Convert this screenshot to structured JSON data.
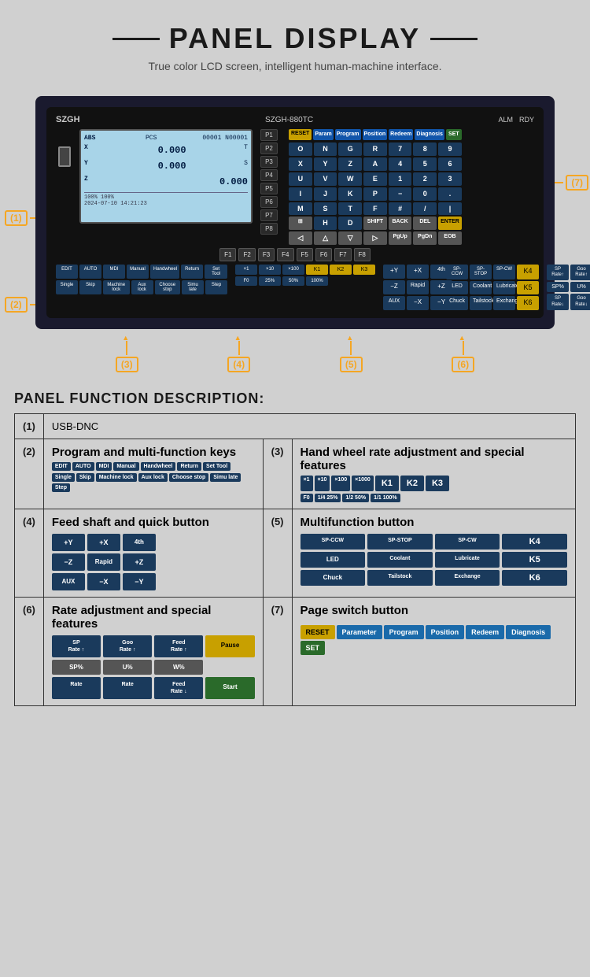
{
  "header": {
    "title": "PANEL DISPLAY",
    "subtitle": "True color LCD screen, intelligent human-machine interface."
  },
  "panel": {
    "brand": "SZGH",
    "model": "SZGH-880TC",
    "status": {
      "alm": "ALM",
      "rdy": "RDY"
    },
    "lcd": {
      "lines": [
        {
          "label": "ABS",
          "extra": "PCS"
        },
        {
          "label": "X",
          "value": "0.000"
        },
        {
          "label": "Y",
          "value": "0.000"
        },
        {
          "label": "Z",
          "value": "0.000"
        }
      ]
    }
  },
  "annotations": {
    "1": "(1)",
    "2": "(2)",
    "3": "(3)",
    "4": "(4)",
    "5": "(5)",
    "6": "(6)",
    "7": "(7)"
  },
  "section_title": "PANEL FUNCTION DESCRIPTION:",
  "functions": [
    {
      "num": "(1)",
      "description": "USB-DNC"
    },
    {
      "num": "(2)",
      "title": "Program and multi-function keys",
      "keys_row1": [
        "EDIT",
        "AUTO",
        "MDI",
        "Manual",
        "Handwheel",
        "Return",
        "Set Tool"
      ],
      "keys_row2": [
        "Single",
        "Skip",
        "Machine lock",
        "Aux lock",
        "Choose stop",
        "Simu late",
        "Step"
      ]
    },
    {
      "num": "(3)",
      "title": "Hand wheel rate adjustment and special features",
      "keys_row1": [
        "×1",
        "×10",
        "×100",
        "×1000",
        "K1",
        "K2",
        "K3"
      ],
      "keys_row2": [
        "F0",
        "1/,25%",
        "1/,50%",
        "1/1,100%"
      ]
    },
    {
      "num": "(4)",
      "title": "Feed shaft and quick button",
      "keys": [
        "+Y",
        "+X",
        "4th",
        "−Z",
        "Rapid",
        "+Z",
        "AUX",
        "−X",
        "−Y"
      ]
    },
    {
      "num": "(5)",
      "title": "Multifunction button",
      "keys": [
        "SP-CCW",
        "SP-STOP",
        "SP-CW",
        "K4",
        "LED",
        "Coolant",
        "Lubricate",
        "K5",
        "Chuck",
        "Tailstock",
        "Exchange",
        "K6"
      ]
    },
    {
      "num": "(6)",
      "title": "Rate adjustment and special features",
      "keys_row1": [
        "SP Rate ↑",
        "Goo Rate ↑",
        "Feed Rate ↑",
        "Pause"
      ],
      "keys_row2": [
        "SP%",
        "U%",
        "W%",
        ""
      ],
      "keys_row3": [
        "SP Rate ↓",
        "Goo Rate ↓",
        "Feed Rate ↓",
        "Start"
      ]
    },
    {
      "num": "(7)",
      "title": "Page switch button",
      "keys": [
        "RESET",
        "Parameter",
        "Program",
        "Position",
        "Redeem",
        "Diagnosis",
        "SET"
      ]
    }
  ],
  "rate_texts": {
    "sp_rate": "SP\nRate",
    "goo_rate": "Goo\nRate",
    "feed_rate": "Feed\nRate",
    "sp_rate_dn": "SP\nRate",
    "goo_rate_dn": "Goo\nRate",
    "feed_rate_dn": "Feed\nRate",
    "pause": "Pause",
    "start": "Start",
    "rate1": "Rate",
    "rate2": "Rate"
  }
}
